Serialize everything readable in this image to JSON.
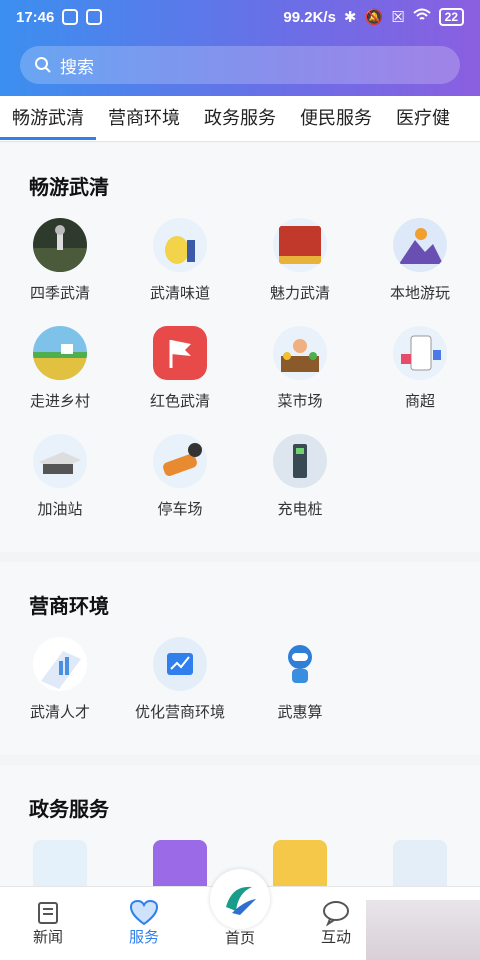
{
  "status": {
    "time": "17:46",
    "speed": "99.2K/s",
    "battery": "22"
  },
  "search": {
    "placeholder": "搜索"
  },
  "tabs": [
    "畅游武清",
    "营商环境",
    "政务服务",
    "便民服务",
    "医疗健"
  ],
  "sections": [
    {
      "title": "畅游武清",
      "items": [
        "四季武清",
        "武清味道",
        "魅力武清",
        "本地游玩",
        "走进乡村",
        "红色武清",
        "菜市场",
        "商超",
        "加油站",
        "停车场",
        "充电桩"
      ]
    },
    {
      "title": "营商环境",
      "items": [
        "武清人才",
        "优化营商环境",
        "武惠算"
      ]
    },
    {
      "title": "政务服务",
      "items": []
    }
  ],
  "nav": [
    "新闻",
    "服务",
    "首页",
    "互动"
  ],
  "colors": {
    "accent": "#2f80ed",
    "header_start": "#3b8ff0",
    "header_end": "#8a5fe0"
  }
}
